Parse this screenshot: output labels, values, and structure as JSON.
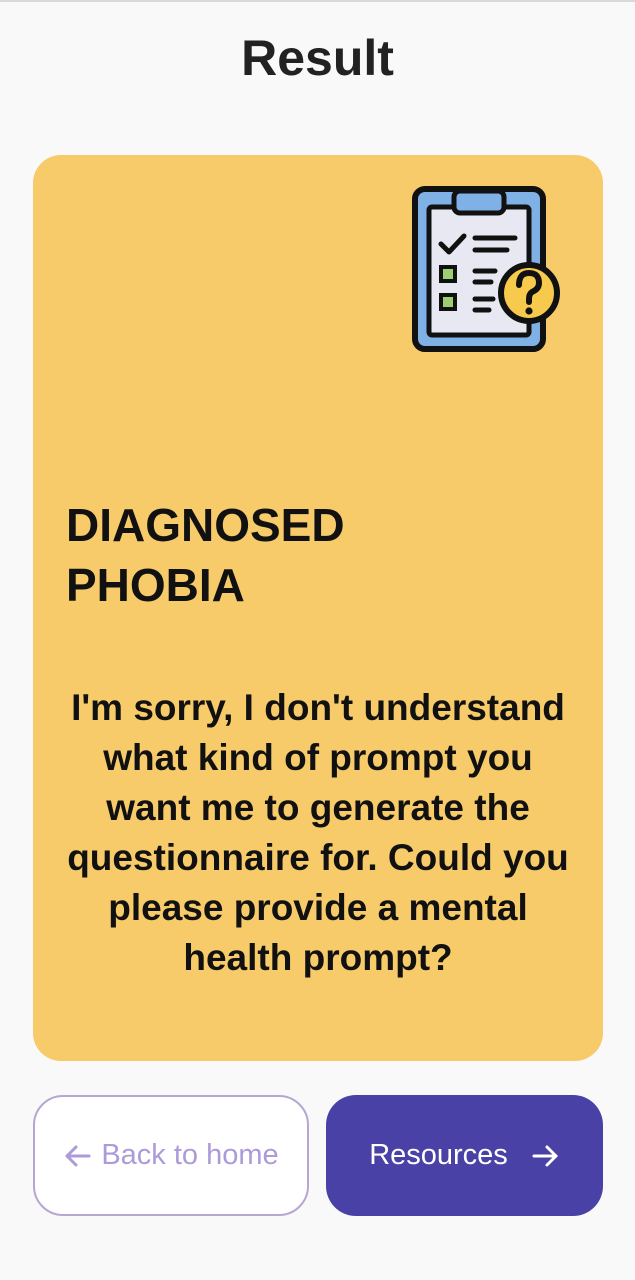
{
  "header": {
    "title": "Result"
  },
  "card": {
    "heading": "DIAGNOSED PHOBIA",
    "message": "I'm sorry, I don't understand what kind of prompt you want me to generate the questionnaire for. Could you please provide a mental health prompt?",
    "icon": "clipboard-question-icon",
    "background_color": "#f7cb69"
  },
  "actions": {
    "back_label": "Back to home",
    "resources_label": "Resources",
    "back_icon": "arrow-left-icon",
    "resources_icon": "arrow-right-icon"
  },
  "colors": {
    "primary": "#4a41a6",
    "secondary_text": "#ad9bd9",
    "secondary_border": "#b6a6d3"
  }
}
